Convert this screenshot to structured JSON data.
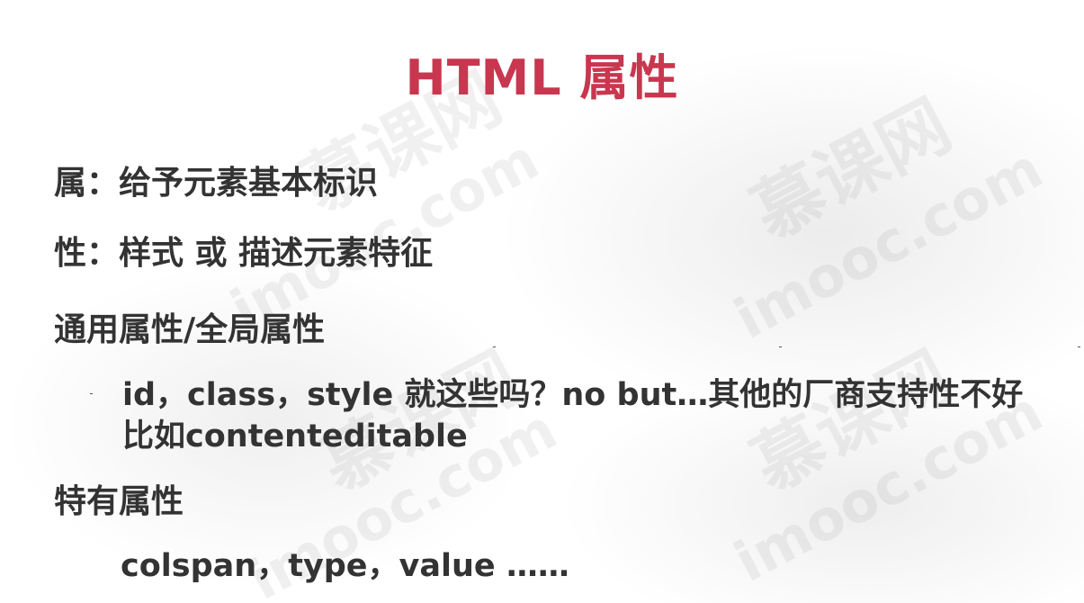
{
  "slide": {
    "title": "HTML 属性",
    "lines": {
      "attr_def": "属：给予元素基本标识",
      "prop_def": "性：样式 或 描述元素特征",
      "common_heading": "通用属性/全局属性",
      "common_items": "id，class，style 就这些吗？no but…其他的厂商支持性不好",
      "common_example": "比如contenteditable",
      "specific_heading": "特有属性",
      "specific_items": "colspan，type，value ……"
    }
  },
  "watermark": {
    "chinese": "慕课网",
    "domain": "imooc.com"
  }
}
